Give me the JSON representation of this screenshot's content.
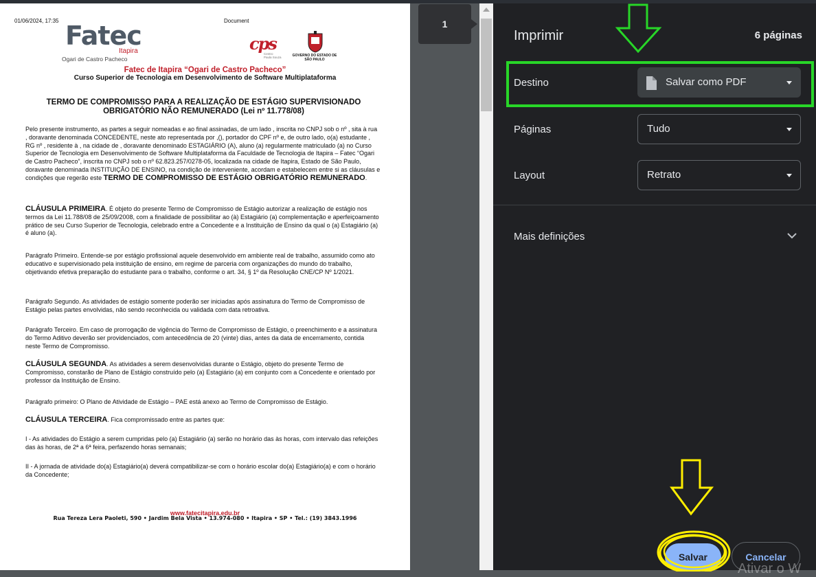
{
  "document": {
    "header_date": "01/06/2024, 17:35",
    "header_title": "Document",
    "logo": {
      "brand": "Fatec",
      "city": "Itapira",
      "subtitle": "Ogari de Castro Pacheco",
      "cps": "cps",
      "cps_sub": "Centro Paula Souza",
      "gov": "GOVERNO DO ESTADO DE SÃO PAULO"
    },
    "institution": "Fatec de Itapira “Ogari de Castro Pacheco”",
    "course": "Curso Superior de Tecnologia em Desenvolvimento de Software Multiplataforma",
    "title_line1": "TERMO DE COMPROMISSO PARA A REALIZAÇÃO DE ESTÁGIO SUPERVISIONADO",
    "title_line2": "OBRIGATÓRIO NÃO REMUNERADO (Lei nº 11.778/08)",
    "intro": "Pelo presente instrumento, as partes a seguir nomeadas e ao final assinadas, de um lado , inscrita no CNPJ sob o nº , sita à rua , doravante denominada CONCEDENTE, neste ato representada por ,(), portador do CPF nº e, de outro lado, o(a) estudante , RG nº , residente à , na cidade de , doravante denominado ESTAGIÁRIO (A), aluno (a) regularmente matriculado (a) no Curso Superior de Tecnologia em Desenvolvimento de Software Multiplataforma da Faculdade de Tecnologia de Itapira – Fatec “Ogari de Castro Pacheco”, inscrita no CNPJ sob o nº 62.823.257/0278-05, localizada na cidade de Itapira, Estado de São Paulo, doravante denominada INSTITUIÇÃO DE ENSINO, na condição de interveniente, acordam e estabelecem entre si as cláusulas e condições que regerão este",
    "intro_bold": "TERMO DE COMPROMISSO DE ESTÁGIO OBRIGATÓRIO REMUNERADO",
    "clause1_title": "CLÁUSULA PRIMEIRA",
    "clause1_text": ". É objeto do presente Termo de Compromisso de Estágio autorizar a realização de estágio nos termos da Lei 11.788/08 de 25/09/2008, com a finalidade de possibilitar ao (à) Estagiário (a) complementação e aperfeiçoamento prático de seu Curso Superior de Tecnologia, celebrado entre a Concedente e a Instituição de Ensino da qual o (a) Estagiário (a) é aluno (a).",
    "par1": "Parágrafo Primeiro. Entende-se por estágio profissional aquele desenvolvido em ambiente real de trabalho, assumido como ato educativo e supervisionado pela instituição de ensino, em regime de parceria com organizações do mundo do trabalho, objetivando efetiva preparação do estudante para o trabalho, conforme o art. 34, § 1º da Resolução CNE/CP Nº 1/2021.",
    "par2": "Parágrafo Segundo. As atividades de estágio somente poderão ser iniciadas após assinatura do Termo de Compromisso de Estágio pelas partes envolvidas, não sendo reconhecida ou validada com data retroativa.",
    "par3": "Parágrafo Terceiro. Em caso de prorrogação de vigência do Termo de Compromisso de Estágio, o preenchimento e a assinatura do Termo Aditivo deverão ser providenciados, com antecedência de 20 (vinte) dias, antes da data de encerramento, contida neste Termo de Compromisso.",
    "clause2_title": "CLÁUSULA SEGUNDA",
    "clause2_text": ". As atividades a serem desenvolvidas durante o Estágio, objeto do presente Termo de Compromisso, constarão de Plano de Estágio construído pelo (a) Estagiário (a) em conjunto com a Concedente e orientado por professor da Instituição de Ensino.",
    "par4": "Parágrafo primeiro: O Plano de Atividade de Estágio – PAE está anexo ao Termo de Compromisso de Estágio.",
    "clause3_title": "CLÁUSULA TERCEIRA",
    "clause3_text": ". Fica compromissado entre as partes que:",
    "item1": "I - As atividades do Estágio a serem cumpridas pelo (a) Estagiário (a) serão no horário das às horas, com intervalo das refeições das às horas, de 2ª a 6ª feira, perfazendo horas semanais;",
    "item2": "II - A jornada de atividade do(a) Estagiário(a) deverá compatibilizar-se com o horário escolar do(a) Estagiário(a) e com o horário da Concedente;",
    "footer_url": "www.fatecitapira.edu.br",
    "footer_address": "Rua Tereza Lera Paoleti, 590 • Jardim Bela Vista • 13.974-080 • Itapira • SP • Tel.: (19) 3843.1996"
  },
  "thumbnail": {
    "page_number": "1"
  },
  "print": {
    "title": "Imprimir",
    "page_count": "6 páginas",
    "destination_label": "Destino",
    "destination_value": "Salvar como PDF",
    "pages_label": "Páginas",
    "pages_value": "Tudo",
    "layout_label": "Layout",
    "layout_value": "Retrato",
    "more_settings": "Mais definições",
    "save_button": "Salvar",
    "cancel_button": "Cancelar"
  },
  "watermark": "Ativar o W",
  "colors": {
    "panel_bg": "#202124",
    "accent": "#8ab4f8",
    "annotation_green": "#28d628",
    "annotation_yellow": "#ffee00"
  }
}
